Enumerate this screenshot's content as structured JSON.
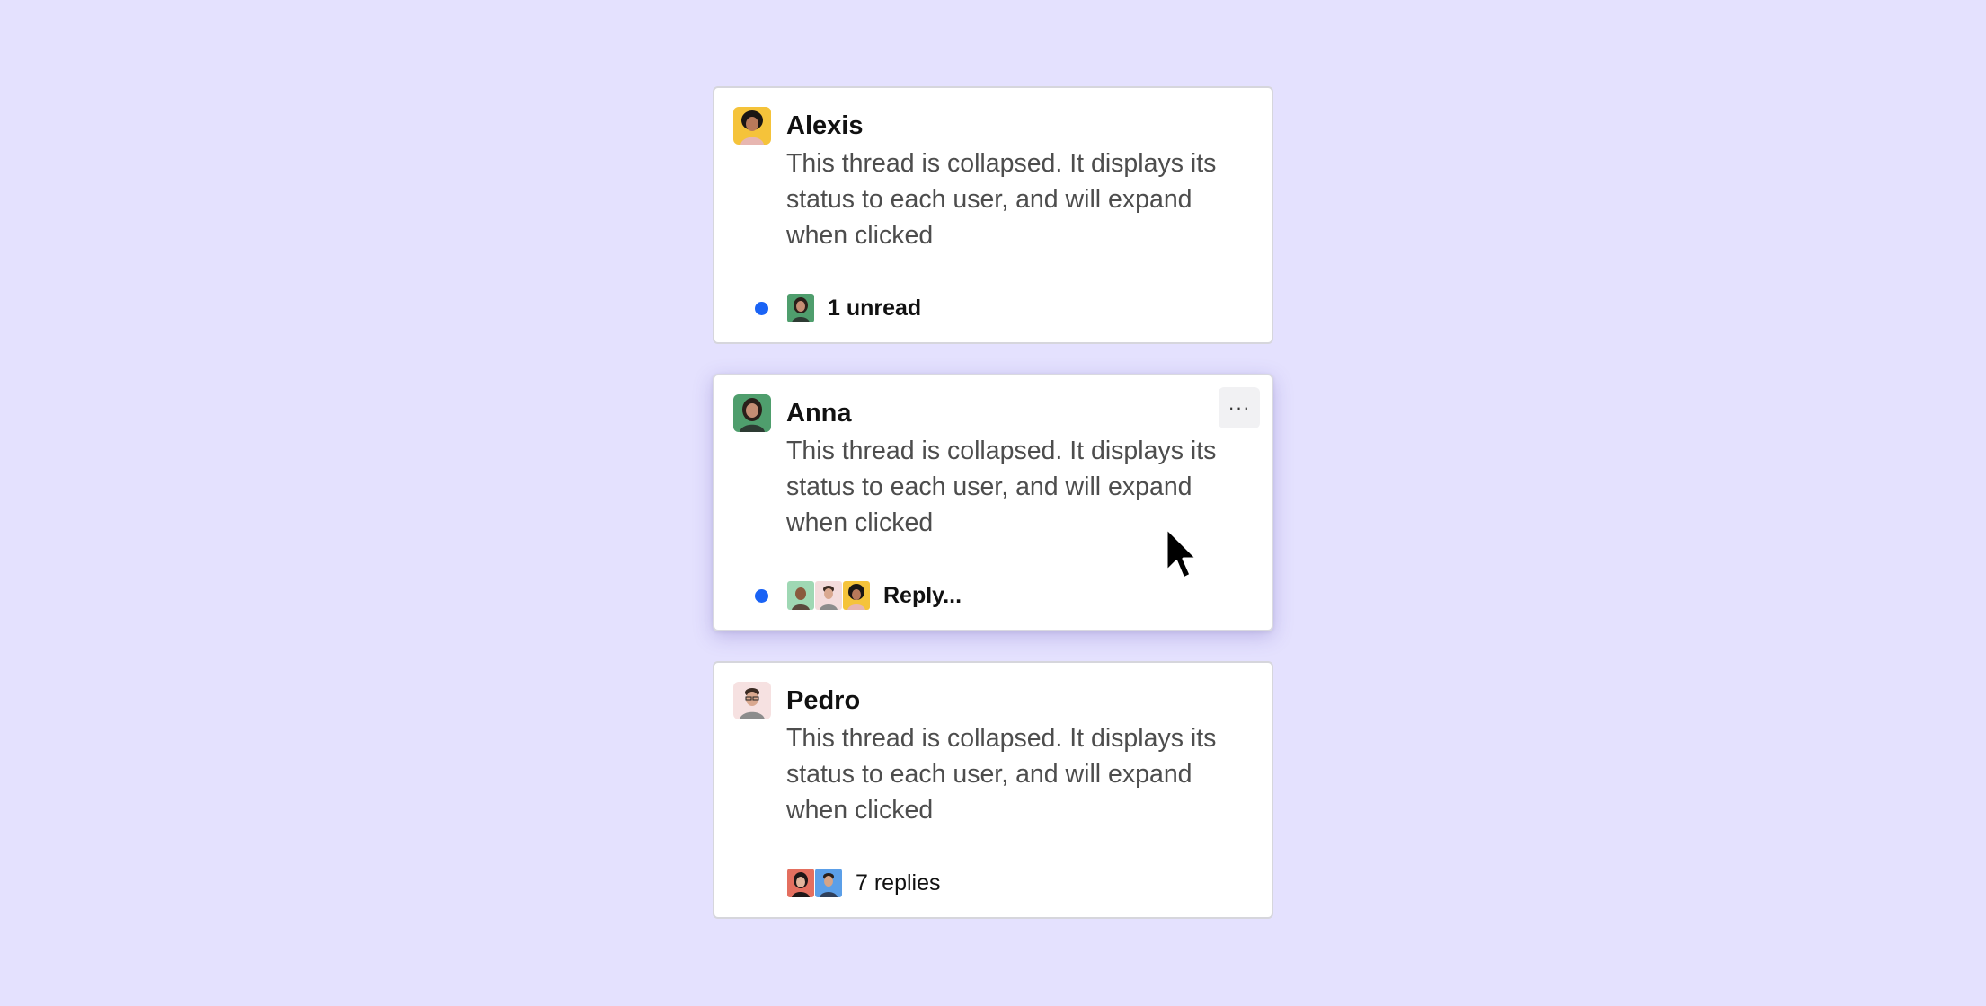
{
  "threads": [
    {
      "author": "Alexis",
      "avatar_icon": "alexis-avatar",
      "body": "This thread is collapsed. It displays its status to each user, and will expand when clicked",
      "unread_dot": true,
      "footer_label": "1 unread",
      "footer_bold": true,
      "participants": [
        "anna-avatar"
      ]
    },
    {
      "author": "Anna",
      "avatar_icon": "anna-avatar",
      "body": "This thread is collapsed. It displays its status to each user, and will expand when clicked",
      "unread_dot": true,
      "footer_label": "Reply...",
      "footer_bold": true,
      "participants": [
        "participant-1-avatar",
        "pedro-avatar",
        "alexis-avatar"
      ],
      "more_button_label": "···",
      "hovered": true
    },
    {
      "author": "Pedro",
      "avatar_icon": "pedro-avatar",
      "body": "This thread is collapsed. It displays its status to each user, and will expand when clicked",
      "unread_dot": false,
      "footer_label": "7 replies",
      "footer_bold": false,
      "participants": [
        "participant-2-avatar",
        "participant-3-avatar"
      ]
    }
  ],
  "colors": {
    "background": "#e4e1fe",
    "unread_dot": "#1a63f5",
    "card": "#ffffff",
    "body_text": "#4d4d4d"
  },
  "cursor_icon": "mouse-pointer-icon"
}
